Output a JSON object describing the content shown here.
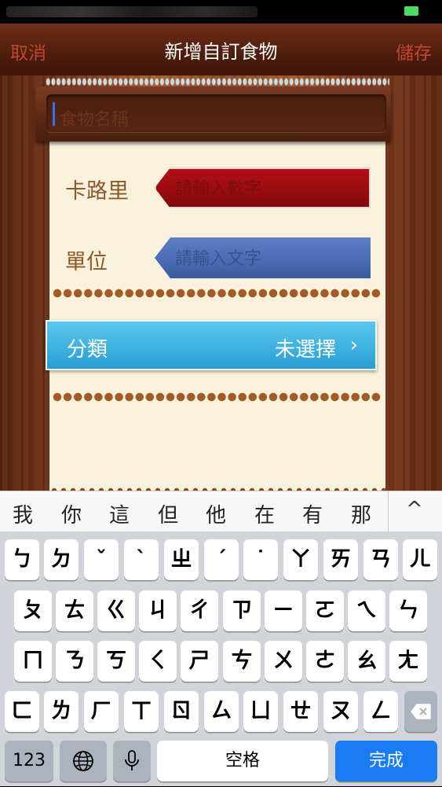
{
  "nav": {
    "cancel_label": "取消",
    "title": "新增自訂食物",
    "save_label": "儲存"
  },
  "food_name": {
    "placeholder": "食物名稱"
  },
  "calories": {
    "label": "卡路里",
    "placeholder": "請輸入數字"
  },
  "unit": {
    "label": "單位",
    "placeholder": "請輸入文字"
  },
  "category": {
    "label": "分類",
    "value": "未選擇",
    "chevron": "›"
  },
  "candidates": {
    "items": [
      "我",
      "你",
      "這",
      "但",
      "他",
      "在",
      "有",
      "那"
    ],
    "toggle": "^"
  },
  "keyboard": {
    "row1": [
      "ㄅ",
      "ㄉ",
      "ˇ",
      "ˋ",
      "ㄓ",
      "ˊ",
      "˙",
      "ㄚ",
      "ㄞ",
      "ㄢ",
      "ㄦ"
    ],
    "row2": [
      "ㄆ",
      "ㄊ",
      "ㄍ",
      "ㄐ",
      "ㄔ",
      "ㄗ",
      "ㄧ",
      "ㄛ",
      "ㄟ",
      "ㄣ"
    ],
    "row3": [
      "ㄇ",
      "ㄋ",
      "ㄎ",
      "ㄑ",
      "ㄕ",
      "ㄘ",
      "ㄨ",
      "ㄜ",
      "ㄠ",
      "ㄤ"
    ],
    "row4": [
      "ㄈ",
      "ㄌ",
      "ㄏ",
      "ㄒ",
      "ㄖ",
      "ㄙ",
      "ㄩ",
      "ㄝ",
      "ㄡ",
      "ㄥ"
    ],
    "numbers_label": "123",
    "space_label": "空格",
    "done_label": "完成",
    "icons": {
      "globe": "globe-icon",
      "mic": "microphone-icon",
      "delete": "backspace-icon"
    }
  },
  "colors": {
    "nav_action": "#c4452f",
    "done_key": "#1a7bf2",
    "category": "#3fb2e0",
    "calorie_ribbon": "#9a0c10",
    "unit_ribbon": "#4a6cb7"
  }
}
